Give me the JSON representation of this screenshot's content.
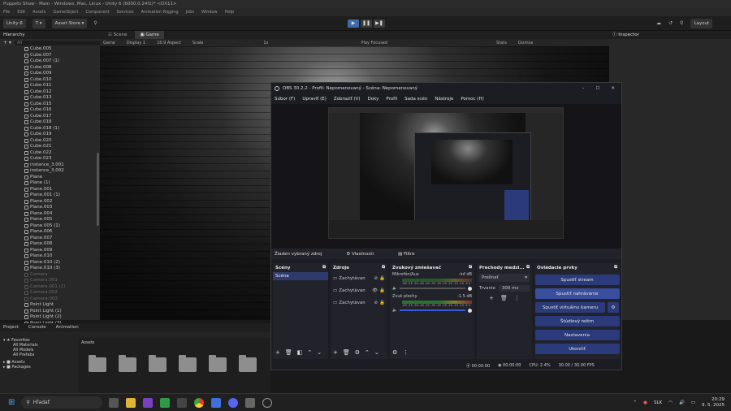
{
  "window": {
    "title": "Puppets Show - Main - Windows, Mac, Linux - Unity 6 (6000.0.24f1)* <DX11>"
  },
  "menu": [
    "File",
    "Edit",
    "Assets",
    "GameObject",
    "Component",
    "Services",
    "Animation Rigging",
    "Jobs",
    "Window",
    "Help"
  ],
  "toolbar": {
    "account": "Unity 6",
    "asset_store": "Asset Store ▾",
    "layout": "Layout"
  },
  "hierarchy": {
    "tab": "Hierarchy",
    "search_placeholder": "All",
    "items": [
      "Cube.005",
      "Cube.007",
      "Cube.007 (1)",
      "Cube.008",
      "Cube.009",
      "Cube.010",
      "Cube.011",
      "Cube.012",
      "Cube.013",
      "Cube.015",
      "Cube.016",
      "Cube.017",
      "Cube.018",
      "Cube.018 (1)",
      "Cube.019",
      "Cube.020",
      "Cube.021",
      "Cube.022",
      "Cube.023",
      "instance_3.001",
      "instance_3.002",
      "Plane",
      "Plane (1)",
      "Plane.001",
      "Plane.001 (1)",
      "Plane.002",
      "Plane.003",
      "Plane.004",
      "Plane.005",
      "Plane.005 (1)",
      "Plane.006",
      "Plane.007",
      "Plane.008",
      "Plane.009",
      "Plane.010",
      "Plane.010 (2)",
      "Plane.010 (3)"
    ],
    "dim_items": [
      "Camera",
      "Camera.001",
      "Camera.001 (1)",
      "Camera.002",
      "Camera.003"
    ],
    "lights": [
      "Point Light",
      "Point Light (1)",
      "Point Light (2)",
      "Point Light (3)"
    ]
  },
  "scene": {
    "tabs": [
      "Scene",
      "Game"
    ],
    "game_dropdown": "Game",
    "display": "Display 1",
    "aspect": "16:9 Aspect",
    "scale_label": "Scale",
    "scale_value": "1x",
    "play_focused": "Play Focused",
    "stats": "Stats",
    "gizmos": "Gizmos"
  },
  "inspector": {
    "tab": "Inspector"
  },
  "project": {
    "tabs": [
      "Project",
      "Console",
      "Animation"
    ],
    "favorites": "Favorites",
    "fav_items": [
      "All Materials",
      "All Models",
      "All Prefabs"
    ],
    "assets_label": "Assets",
    "packages_label": "Packages",
    "breadcrumb": "Assets"
  },
  "obs": {
    "title": "OBS 30.2.2 - Profil: Nepomenovaný - Scéna: Nepomenovaný",
    "menu": [
      "Súbor (F)",
      "Upraviť (E)",
      "Zobraziť (V)",
      "Doky",
      "Profil",
      "Sada scén",
      "Nástroje",
      "Pomoc (H)"
    ],
    "no_source": "Žiaden vybraný zdroj",
    "properties": "Vlastnosti",
    "filters": "Filtre",
    "docks": {
      "scenes": {
        "title": "Scény",
        "items": [
          "Scéna"
        ]
      },
      "sources": {
        "title": "Zdroje",
        "items": [
          "Zachytávan",
          "Zachytávan",
          "Zachytávan"
        ]
      },
      "mixer": {
        "title": "Zvukový zmiešavač",
        "ch1_name": "Mikrofón/Aux",
        "ch1_db": "-inf dB",
        "ch2_name": "Zvuk plochy",
        "ch2_db": "-1.5 dB",
        "scale": "-60 -55 -50 -45 -40 -35 -30 -25 -20 -15 -10 -5 0"
      },
      "transitions": {
        "title": "Prechody medzi...",
        "type": "Prelínať",
        "duration_label": "Trvanie",
        "duration": "300 ms"
      },
      "controls": {
        "title": "Ovládacie prvky",
        "buttons": [
          "Spustiť stream",
          "Spustiť nahrávanie",
          "Spustiť virtuálnu kameru",
          "Štúdiový režim",
          "Nastavenia",
          "Ukončiť"
        ]
      }
    },
    "status": {
      "rec_time": "00:00:00",
      "stream_time": "00:00:00",
      "cpu": "CPU: 2.4%",
      "fps": "30.00 / 30.00 FPS"
    }
  },
  "taskbar": {
    "search_placeholder": "Hľadať",
    "lang": "SLK",
    "time": "20:29",
    "date": "9. 5. 2025"
  }
}
